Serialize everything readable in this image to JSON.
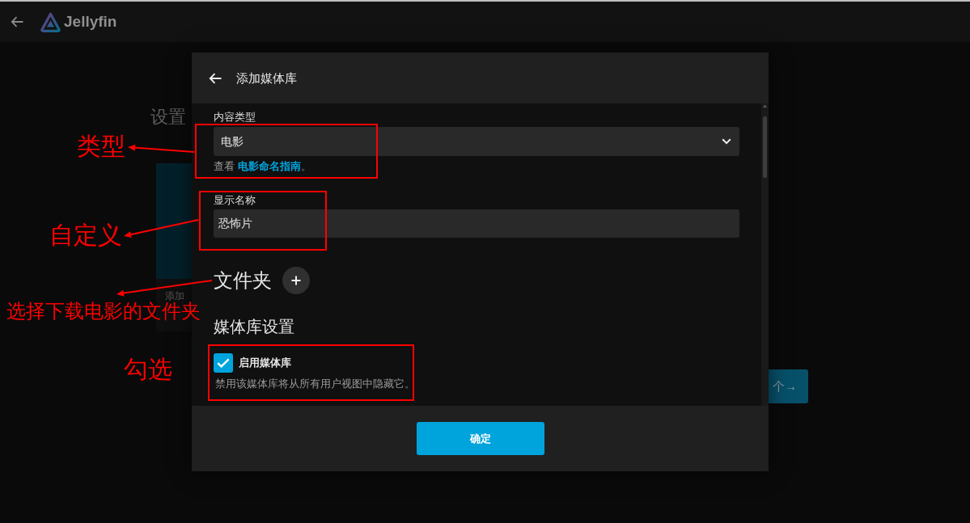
{
  "top_bar": {
    "app_name": "Jellyfin"
  },
  "background_page": {
    "heading": "设置",
    "card_caption": "添加",
    "next_button": "个→"
  },
  "dialog": {
    "title": "添加媒体库",
    "content_type": {
      "label": "内容类型",
      "value": "电影",
      "hint": "查看",
      "hint_link": "电影命名指南",
      "hint_end": "。"
    },
    "display_name": {
      "label": "显示名称",
      "value": "恐怖片"
    },
    "folders": {
      "heading": "文件夹"
    },
    "library_settings": {
      "heading": "媒体库设置",
      "options": [
        {
          "label": "启用媒体库",
          "description": "禁用该媒体库将从所有用户视图中隐藏它。",
          "checked": true
        }
      ]
    },
    "confirm_button": "确定"
  },
  "annotations": [
    {
      "text": "类型"
    },
    {
      "text": "自定义"
    },
    {
      "text": "选择下载电影的文件夹"
    },
    {
      "text": "勾选"
    }
  ]
}
